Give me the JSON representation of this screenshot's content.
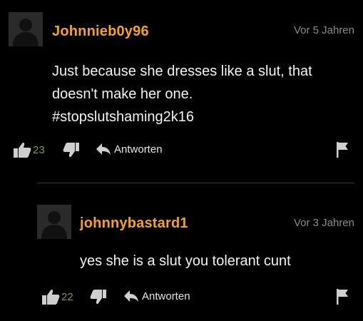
{
  "comments": [
    {
      "username": "Johnnieb0y96",
      "time": "Vor 5 Jahren",
      "body_lines": [
        "Just because she dresses like a slut, that",
        "doesn't make her one.",
        "#stopslutshaming2k16"
      ],
      "likes": "23",
      "reply_label": "Antworten",
      "icons": [
        "avatar-placeholder",
        "thumbs-up-icon",
        "thumbs-down-icon",
        "reply-arrow-icon",
        "flag-icon"
      ]
    },
    {
      "username": "johnnybastard1",
      "time": "Vor 3 Jahren",
      "body_lines": [
        "yes she is a slut you tolerant cunt"
      ],
      "likes": "22",
      "reply_label": "Antworten",
      "icons": [
        "avatar-placeholder",
        "thumbs-up-icon",
        "thumbs-down-icon",
        "reply-arrow-icon",
        "flag-icon"
      ]
    }
  ],
  "colors": {
    "background": "#000000",
    "username": "#f7a21b",
    "timestamp": "#8a8a8a",
    "like_count": "#7e9a3a",
    "icon": "#cfcfcf"
  }
}
